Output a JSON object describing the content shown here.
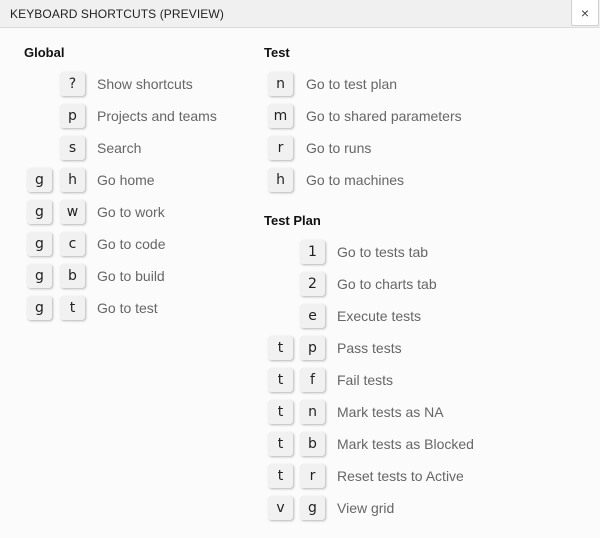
{
  "window": {
    "title": "KEYBOARD SHORTCUTS (PREVIEW)",
    "close_icon": "×"
  },
  "sections": {
    "global": {
      "title": "Global",
      "items": [
        {
          "keys": [
            "?"
          ],
          "label": "Show shortcuts"
        },
        {
          "keys": [
            "p"
          ],
          "label": "Projects and teams"
        },
        {
          "keys": [
            "s"
          ],
          "label": "Search"
        },
        {
          "keys": [
            "g",
            "h"
          ],
          "label": "Go home"
        },
        {
          "keys": [
            "g",
            "w"
          ],
          "label": "Go to work"
        },
        {
          "keys": [
            "g",
            "c"
          ],
          "label": "Go to code"
        },
        {
          "keys": [
            "g",
            "b"
          ],
          "label": "Go to build"
        },
        {
          "keys": [
            "g",
            "t"
          ],
          "label": "Go to test"
        }
      ]
    },
    "test": {
      "title": "Test",
      "items": [
        {
          "keys": [
            "n"
          ],
          "label": "Go to test plan"
        },
        {
          "keys": [
            "m"
          ],
          "label": "Go to shared parameters"
        },
        {
          "keys": [
            "r"
          ],
          "label": "Go to runs"
        },
        {
          "keys": [
            "h"
          ],
          "label": "Go to machines"
        }
      ]
    },
    "test_plan": {
      "title": "Test Plan",
      "items": [
        {
          "keys": [
            "1"
          ],
          "label": "Go to tests tab"
        },
        {
          "keys": [
            "2"
          ],
          "label": "Go to charts tab"
        },
        {
          "keys": [
            "e"
          ],
          "label": "Execute tests"
        },
        {
          "keys": [
            "t",
            "p"
          ],
          "label": "Pass tests"
        },
        {
          "keys": [
            "t",
            "f"
          ],
          "label": "Fail tests"
        },
        {
          "keys": [
            "t",
            "n"
          ],
          "label": "Mark tests as NA"
        },
        {
          "keys": [
            "t",
            "b"
          ],
          "label": "Mark tests as Blocked"
        },
        {
          "keys": [
            "t",
            "r"
          ],
          "label": "Reset tests to Active"
        },
        {
          "keys": [
            "v",
            "g"
          ],
          "label": "View grid"
        }
      ]
    }
  }
}
